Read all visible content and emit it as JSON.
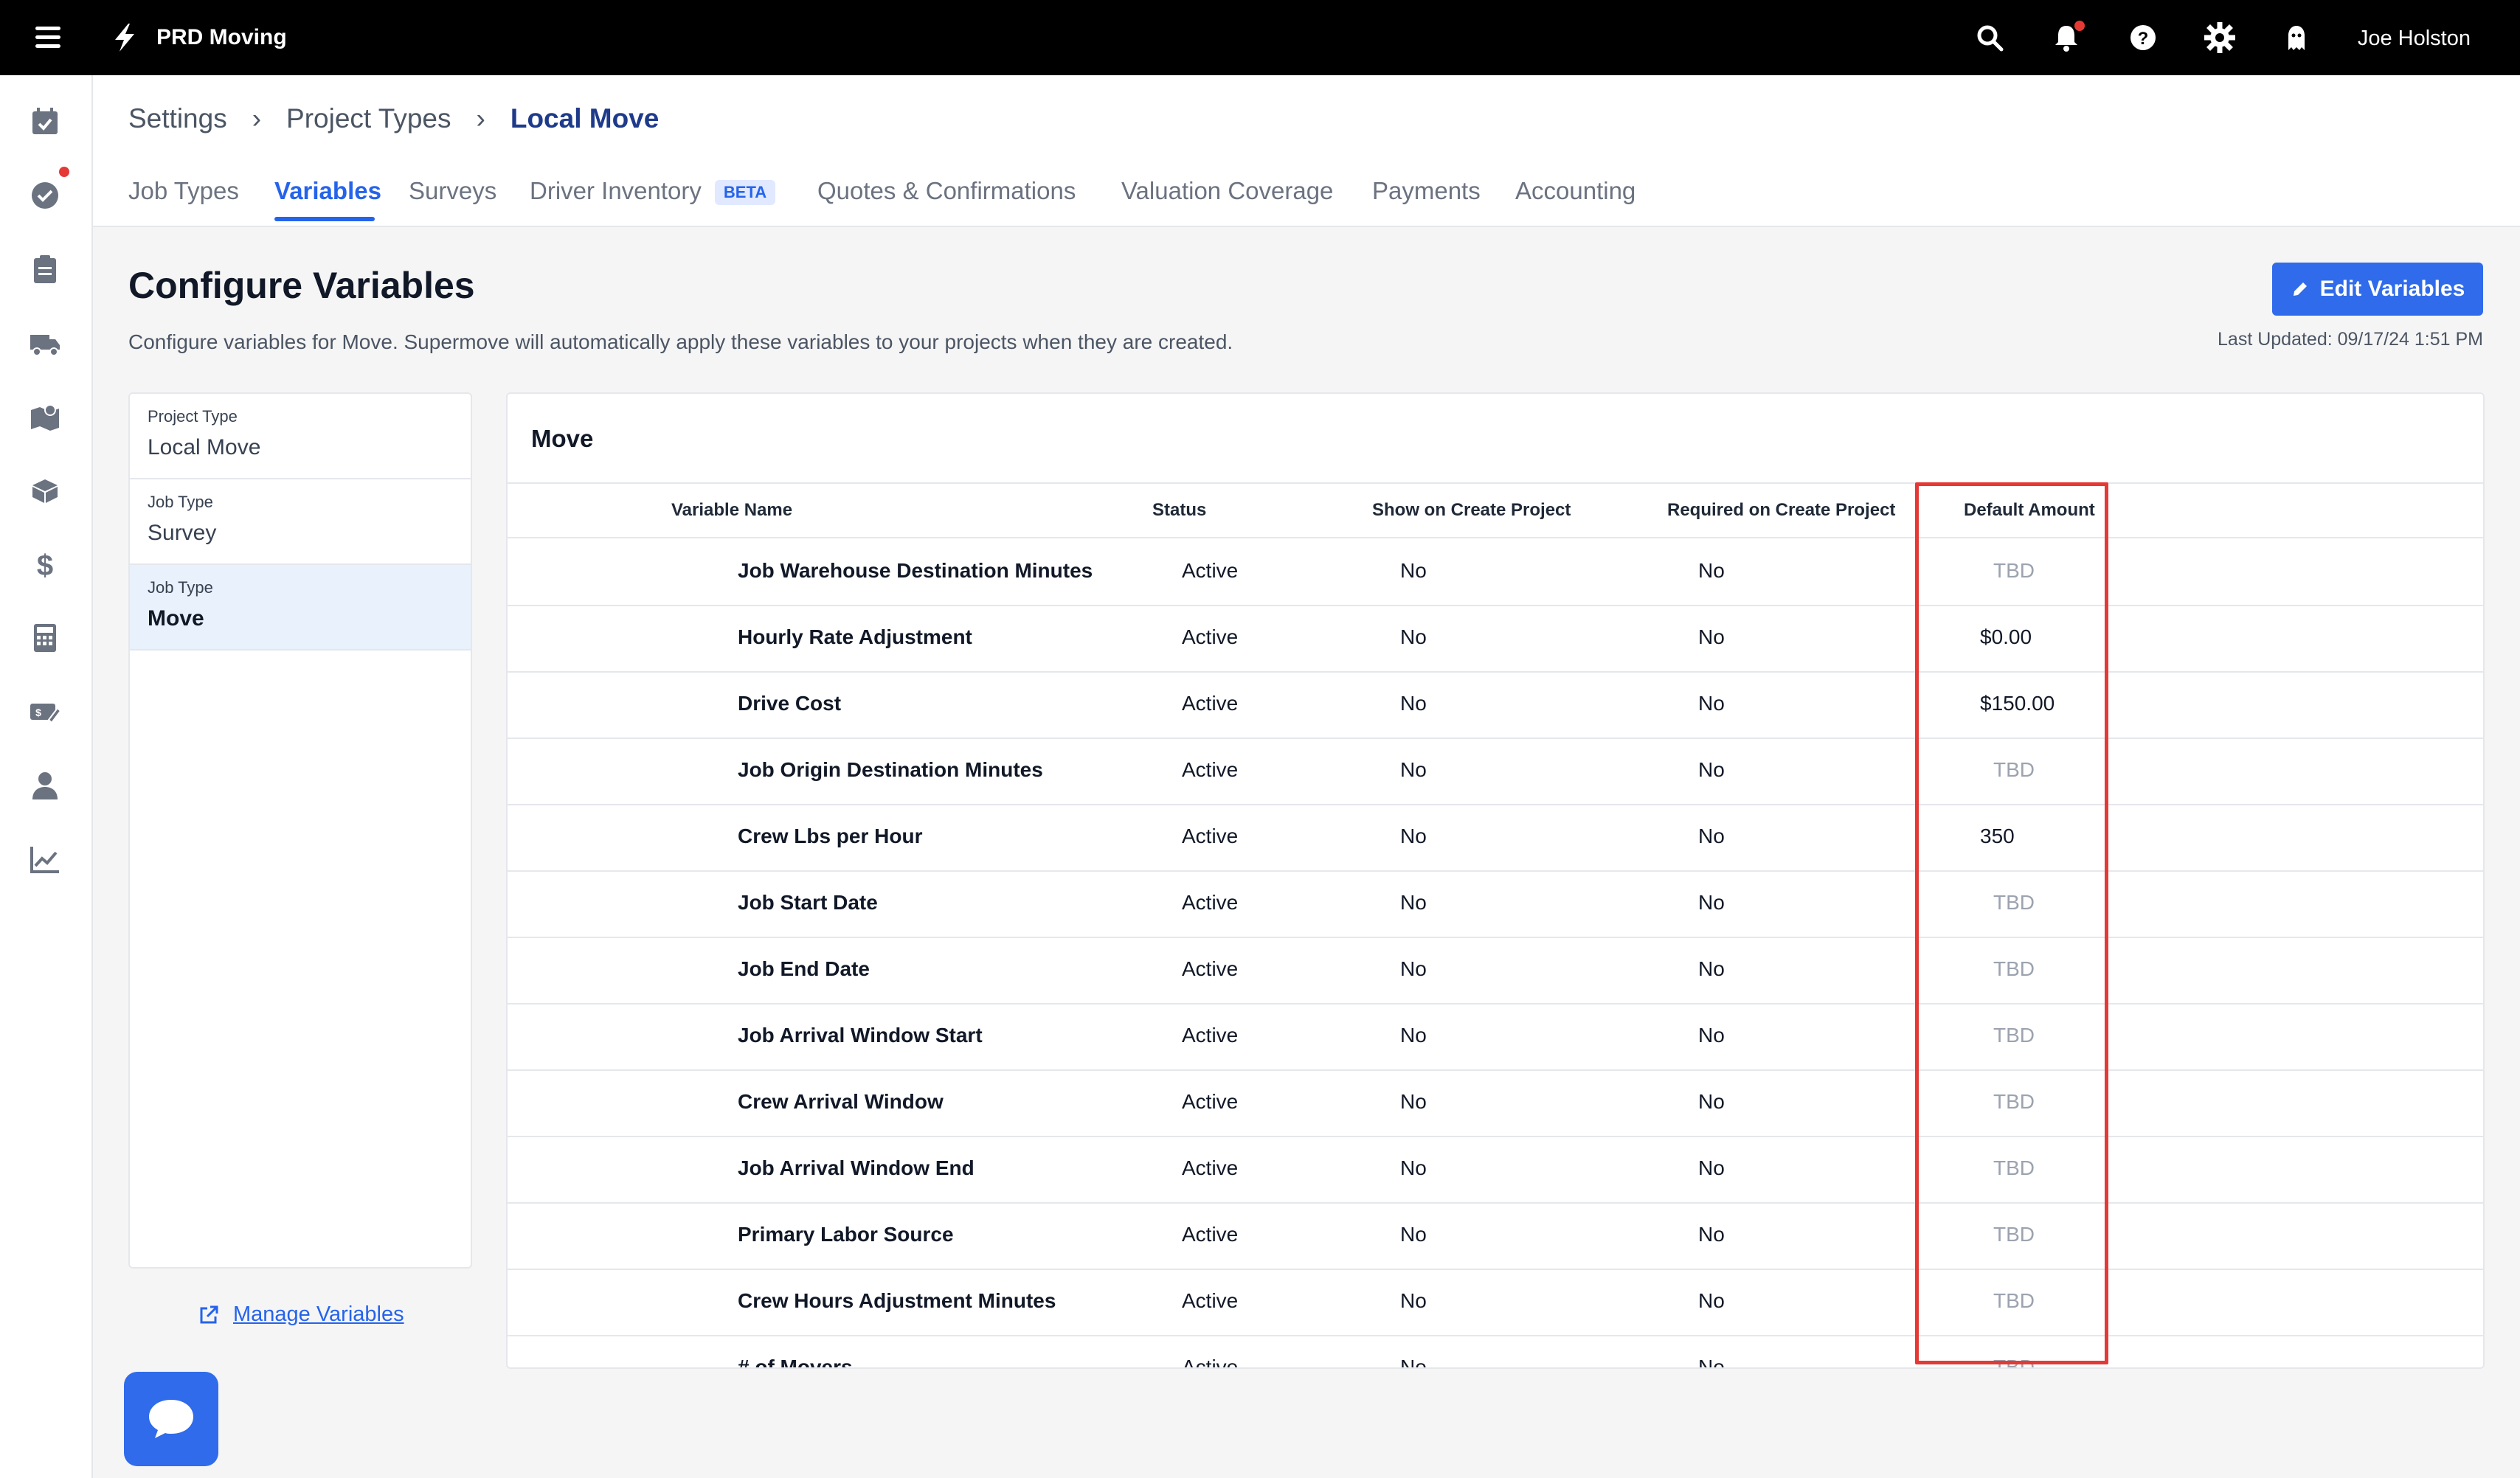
{
  "topbar": {
    "brand": "PRD Moving",
    "user_name": "Joe Holston",
    "icons": [
      "menu-icon",
      "search-icon",
      "bell-icon",
      "help-icon",
      "gear-icon",
      "ghost-icon"
    ]
  },
  "sidebar": {
    "icons": [
      "calendar-check-icon",
      "check-circle-icon",
      "clipboard-icon",
      "truck-icon",
      "map-icon",
      "box-icon",
      "dollar-icon",
      "calculator-icon",
      "money-tag-icon",
      "person-icon",
      "chart-icon"
    ]
  },
  "breadcrumb": {
    "items": [
      "Settings",
      "Project Types"
    ],
    "current": "Local Move",
    "separator": "›"
  },
  "tabs": [
    {
      "label": "Job Types",
      "active": false
    },
    {
      "label": "Variables",
      "active": true
    },
    {
      "label": "Surveys",
      "active": false
    },
    {
      "label": "Driver Inventory",
      "active": false,
      "badge": "BETA"
    },
    {
      "label": "Quotes & Confirmations",
      "active": false
    },
    {
      "label": "Valuation Coverage",
      "active": false
    },
    {
      "label": "Payments",
      "active": false
    },
    {
      "label": "Accounting",
      "active": false
    }
  ],
  "page": {
    "title": "Configure Variables",
    "description": "Configure variables for Move. Supermove will automatically apply these variables to your projects when they are created.",
    "edit_button": "Edit Variables",
    "last_updated": "Last Updated: 09/17/24 1:51 PM"
  },
  "left_panel": {
    "items": [
      {
        "small": "Project Type",
        "big": "Local Move",
        "selected": false
      },
      {
        "small": "Job Type",
        "big": "Survey",
        "selected": false
      },
      {
        "small": "Job Type",
        "big": "Move",
        "selected": true
      }
    ],
    "manage_link": "Manage Variables"
  },
  "table": {
    "title": "Move",
    "columns": [
      "Variable Name",
      "Status",
      "Show on Create Project",
      "Required on Create Project",
      "Default Amount"
    ],
    "rows": [
      {
        "name": "Job Warehouse Destination Minutes",
        "status": "Active",
        "show": "No",
        "required": "No",
        "amount": "TBD"
      },
      {
        "name": "Hourly Rate Adjustment",
        "status": "Active",
        "show": "No",
        "required": "No",
        "amount": "$0.00"
      },
      {
        "name": "Drive Cost",
        "status": "Active",
        "show": "No",
        "required": "No",
        "amount": "$150.00"
      },
      {
        "name": "Job Origin Destination Minutes",
        "status": "Active",
        "show": "No",
        "required": "No",
        "amount": "TBD"
      },
      {
        "name": "Crew Lbs per Hour",
        "status": "Active",
        "show": "No",
        "required": "No",
        "amount": "350"
      },
      {
        "name": "Job Start Date",
        "status": "Active",
        "show": "No",
        "required": "No",
        "amount": "TBD"
      },
      {
        "name": "Job End Date",
        "status": "Active",
        "show": "No",
        "required": "No",
        "amount": "TBD"
      },
      {
        "name": "Job Arrival Window Start",
        "status": "Active",
        "show": "No",
        "required": "No",
        "amount": "TBD"
      },
      {
        "name": "Crew Arrival Window",
        "status": "Active",
        "show": "No",
        "required": "No",
        "amount": "TBD"
      },
      {
        "name": "Job Arrival Window End",
        "status": "Active",
        "show": "No",
        "required": "No",
        "amount": "TBD"
      },
      {
        "name": "Primary Labor Source",
        "status": "Active",
        "show": "No",
        "required": "No",
        "amount": "TBD"
      },
      {
        "name": "Crew Hours Adjustment Minutes",
        "status": "Active",
        "show": "No",
        "required": "No",
        "amount": "TBD"
      },
      {
        "name": "# of Movers",
        "status": "Active",
        "show": "No",
        "required": "No",
        "amount": "TBD"
      }
    ]
  },
  "colors": {
    "accent": "#2f6bea",
    "topbar": "#000000",
    "highlight": "#e53935",
    "selected_bg": "#e8f1fc"
  }
}
